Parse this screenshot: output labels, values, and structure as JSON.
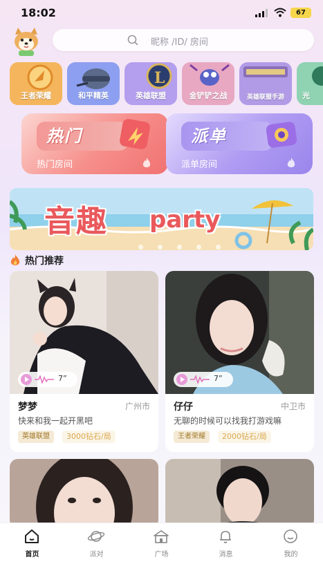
{
  "status_bar": {
    "time": "18:02",
    "battery": "67"
  },
  "search": {
    "placeholder": "昵称 /ID/ 房间"
  },
  "games": [
    {
      "label": "王者荣耀",
      "color": "#f3b45a"
    },
    {
      "label": "和平精英",
      "color": "#9aa6f0"
    },
    {
      "label": "英雄联盟",
      "color": "#b7a1ef"
    },
    {
      "label": "金铲铲之战",
      "color": "#e7a7c0"
    },
    {
      "label": "英雄联盟手游",
      "color": "#b49de9"
    },
    {
      "label": "光",
      "color": "#8fd1b4"
    }
  ],
  "big_cards": [
    {
      "title": "热门",
      "subtitle": "热门房间",
      "color": "#f38684"
    },
    {
      "title": "派单",
      "subtitle": "派单房间",
      "color": "#a791ef"
    }
  ],
  "banner": {
    "title_cn": "音趣",
    "title_en": "party",
    "page_count": 5
  },
  "section": {
    "title": "热门推荐"
  },
  "cards": [
    {
      "name": "梦梦",
      "city": "广州市",
      "signature": "快来和我一起开黑吧",
      "tag": "英雄联盟",
      "price": "3000钻石/局",
      "duration": "7”"
    },
    {
      "name": "仔仔",
      "city": "中卫市",
      "signature": "无聊的时候可以找我打游戏嘛",
      "tag": "王者荣耀",
      "price": "2000钻石/局",
      "duration": "7”"
    }
  ],
  "tabs": [
    {
      "label": "首页",
      "icon": "home-icon",
      "active": true
    },
    {
      "label": "派对",
      "icon": "planet-icon",
      "active": false
    },
    {
      "label": "广场",
      "icon": "plaza-icon",
      "active": false
    },
    {
      "label": "消息",
      "icon": "bell-icon",
      "active": false
    },
    {
      "label": "我的",
      "icon": "smile-icon",
      "active": false
    }
  ]
}
